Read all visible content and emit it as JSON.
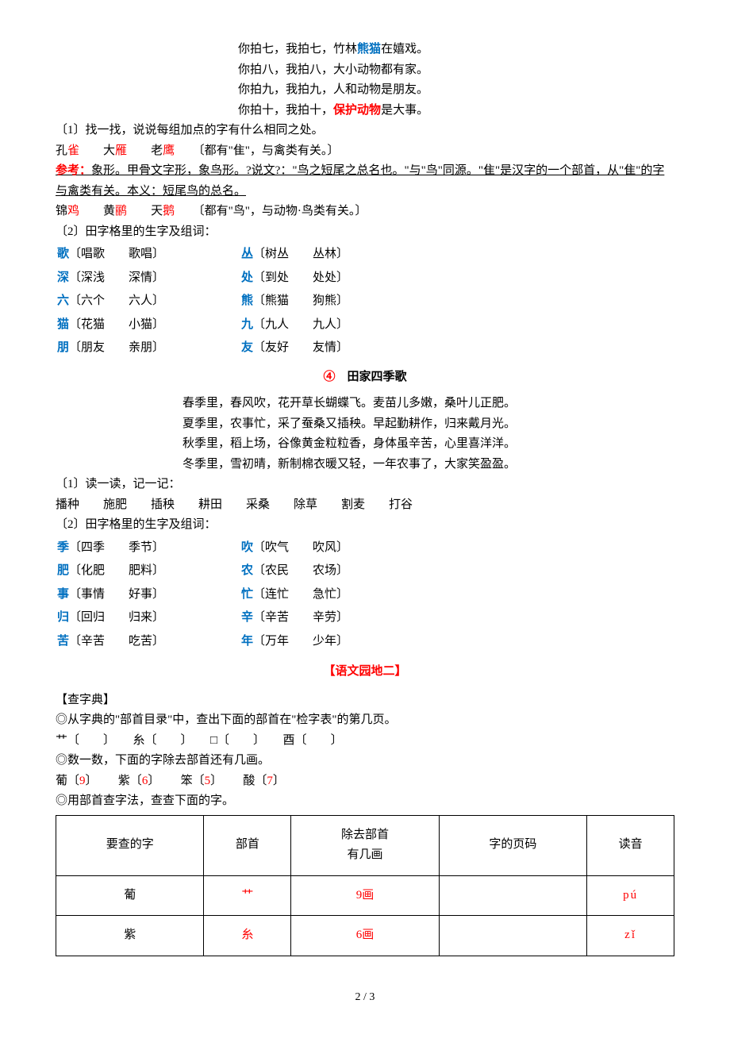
{
  "top_lines": [
    {
      "a": "你拍七",
      "b": "，我拍七",
      "c": "，竹林",
      "kw": "熊猫",
      "d": "在嬉戏。"
    },
    {
      "a": "你拍八",
      "b": "，我拍八",
      "c": "，大小动物都有家。",
      "kw": "",
      "d": ""
    },
    {
      "a": "你拍九",
      "b": "，我拍九",
      "c": "，人和动物是朋友。",
      "kw": "",
      "d": ""
    },
    {
      "a": "你拍十",
      "b": "，我拍十",
      "c": "，",
      "kw": "保护动物",
      "d": "是大事。",
      "kw_red": true
    }
  ],
  "q1": {
    "title": "〔1〕找一找，说说每组加点的字有什么相同之处。",
    "line1": {
      "a": "孔",
      "b": "雀",
      "c": "　　大",
      "d": "雁",
      "e": "　　老",
      "f": "鹰",
      "note": "〔都有\"隹\"，与禽类有关。〕"
    },
    "ref_label": "参考：",
    "ref_text": "象形。甲骨文字形，象鸟形。?说文?：\"鸟之短尾之总名也。\"与\"鸟\"同源。\"隹\"是汉字的一个部首，从\"隹\"的字与禽类有关。本义：短尾鸟的总名。",
    "line2": {
      "a": "锦",
      "b": "鸡",
      "c": "　　黄",
      "d": "鹂",
      "e": "　　天",
      "f": "鹅",
      "note": "〔都有\"鸟\"，与动物·鸟类有关。〕"
    }
  },
  "q2": {
    "title": "〔2〕田字格里的生字及组词：",
    "rows": [
      [
        {
          "hw": "歌",
          "t": "〔唱歌　　歌唱〕"
        },
        {
          "hw": "丛",
          "t": "〔树丛　　丛林〕"
        }
      ],
      [
        {
          "hw": "深",
          "t": "〔深浅　　深情〕"
        },
        {
          "hw": "处",
          "t": "〔到处　　处处〕"
        }
      ],
      [
        {
          "hw": "六",
          "t": "〔六个　　六人〕"
        },
        {
          "hw": "熊",
          "t": "〔熊猫　　狗熊〕"
        }
      ],
      [
        {
          "hw": "猫",
          "t": "〔花猫　　小猫〕"
        },
        {
          "hw": "九",
          "t": "〔九人　　九人〕"
        }
      ],
      [
        {
          "hw": "朋",
          "t": "〔朋友　　亲朋〕"
        },
        {
          "hw": "友",
          "t": "〔友好　　友情〕"
        }
      ]
    ]
  },
  "poem2": {
    "num": "④",
    "title": "田家四季歌",
    "lines": [
      "春季里，春风吹，花开草长蝴蝶飞。麦苗儿多嫩，桑叶儿正肥。",
      "夏季里，农事忙，采了蚕桑又插秧。早起勤耕作，归来戴月光。",
      "秋季里，稻上场，谷像黄金粒粒香，身体虽辛苦，心里喜洋洋。",
      "冬季里，雪初晴，新制棉衣暖又轻，一年农事了，大家笑盈盈。"
    ]
  },
  "q3": {
    "title": "〔1〕读一读，记一记：",
    "words": "播种　　施肥　　插秧　　耕田　　采桑　　除草　　割麦　　打谷"
  },
  "q4": {
    "title": "〔2〕田字格里的生字及组词：",
    "rows": [
      [
        {
          "hw": "季",
          "t": "〔四季　　季节〕"
        },
        {
          "hw": "吹",
          "t": "〔吹气　　吹风〕"
        }
      ],
      [
        {
          "hw": "肥",
          "t": "〔化肥　　肥料〕"
        },
        {
          "hw": "农",
          "t": "〔农民　　农场〕"
        }
      ],
      [
        {
          "hw": "事",
          "t": "〔事情　　好事〕"
        },
        {
          "hw": "忙",
          "t": "〔连忙　　急忙〕"
        }
      ],
      [
        {
          "hw": "归",
          "t": "〔回归　　归来〕"
        },
        {
          "hw": "辛",
          "t": "〔辛苦　　辛劳〕"
        }
      ],
      [
        {
          "hw": "苦",
          "t": "〔辛苦　　吃苦〕"
        },
        {
          "hw": "年",
          "t": "〔万年　　少年〕"
        }
      ]
    ]
  },
  "garden": {
    "title": "【语文园地二】",
    "sub": "【查字典】",
    "l1": "◎从字典的\"部首目录\"中，查出下面的部首在\"检字表\"的第几页。",
    "l1_items": "艹〔　　〕　　糸〔　　〕　　□〔　　〕　　酉〔　　〕",
    "l2": "◎数一数，下面的字除去部首还有几画。",
    "l2_items": [
      {
        "ch": "葡〔",
        "n": "9",
        "end": "〕"
      },
      {
        "ch": "紫〔",
        "n": "6",
        "end": "〕"
      },
      {
        "ch": "笨〔",
        "n": "5",
        "end": "〕"
      },
      {
        "ch": "酸〔",
        "n": "7",
        "end": "〕"
      }
    ],
    "l3": "◎用部首查字法，查查下面的字。"
  },
  "table": {
    "headers": [
      "要查的字",
      "部首",
      "除去部首\n有几画",
      "字的页码",
      "读音"
    ],
    "rows": [
      {
        "c": "葡",
        "r": "艹",
        "s": "9画",
        "p": "",
        "py": "pú"
      },
      {
        "c": "紫",
        "r": "糸",
        "s": "6画",
        "p": "",
        "py": "zǐ"
      }
    ]
  },
  "footer": "2 / 3"
}
